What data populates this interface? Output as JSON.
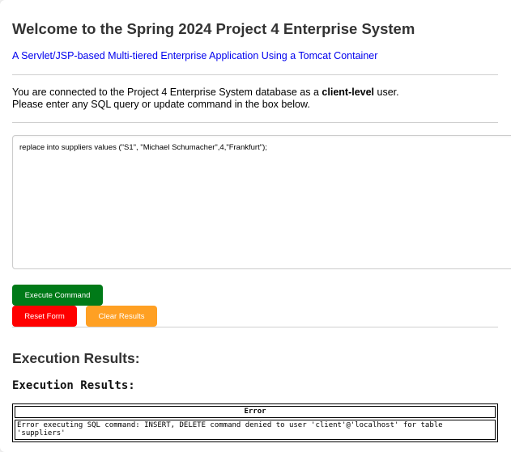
{
  "header": {
    "title": "Welcome to the Spring 2024 Project 4 Enterprise System",
    "subtitle": "A Servlet/JSP-based Multi-tiered Enterprise Application Using a Tomcat Container"
  },
  "info": {
    "line1_prefix": "You are connected to the Project 4 Enterprise System database as a ",
    "user_level": "client-level",
    "line1_suffix": " user.",
    "line2": "Please enter any SQL query or update command in the box below."
  },
  "query": {
    "value": "replace into suppliers values (\"S1\", \"Michael Schumacher\",4,\"Frankfurt\");"
  },
  "buttons": {
    "execute": "Execute Command",
    "reset": "Reset Form",
    "clear": "Clear Results"
  },
  "results": {
    "heading": "Execution Results:",
    "subheading": "Execution Results:",
    "table": {
      "header": "Error",
      "rows": [
        "Error executing SQL command: INSERT, DELETE command denied to user 'client'@'localhost' for table 'suppliers'"
      ]
    }
  },
  "colors": {
    "execute": "#007a18",
    "reset": "#ff0000",
    "clear": "#ffa023",
    "link": "#0000ee"
  }
}
